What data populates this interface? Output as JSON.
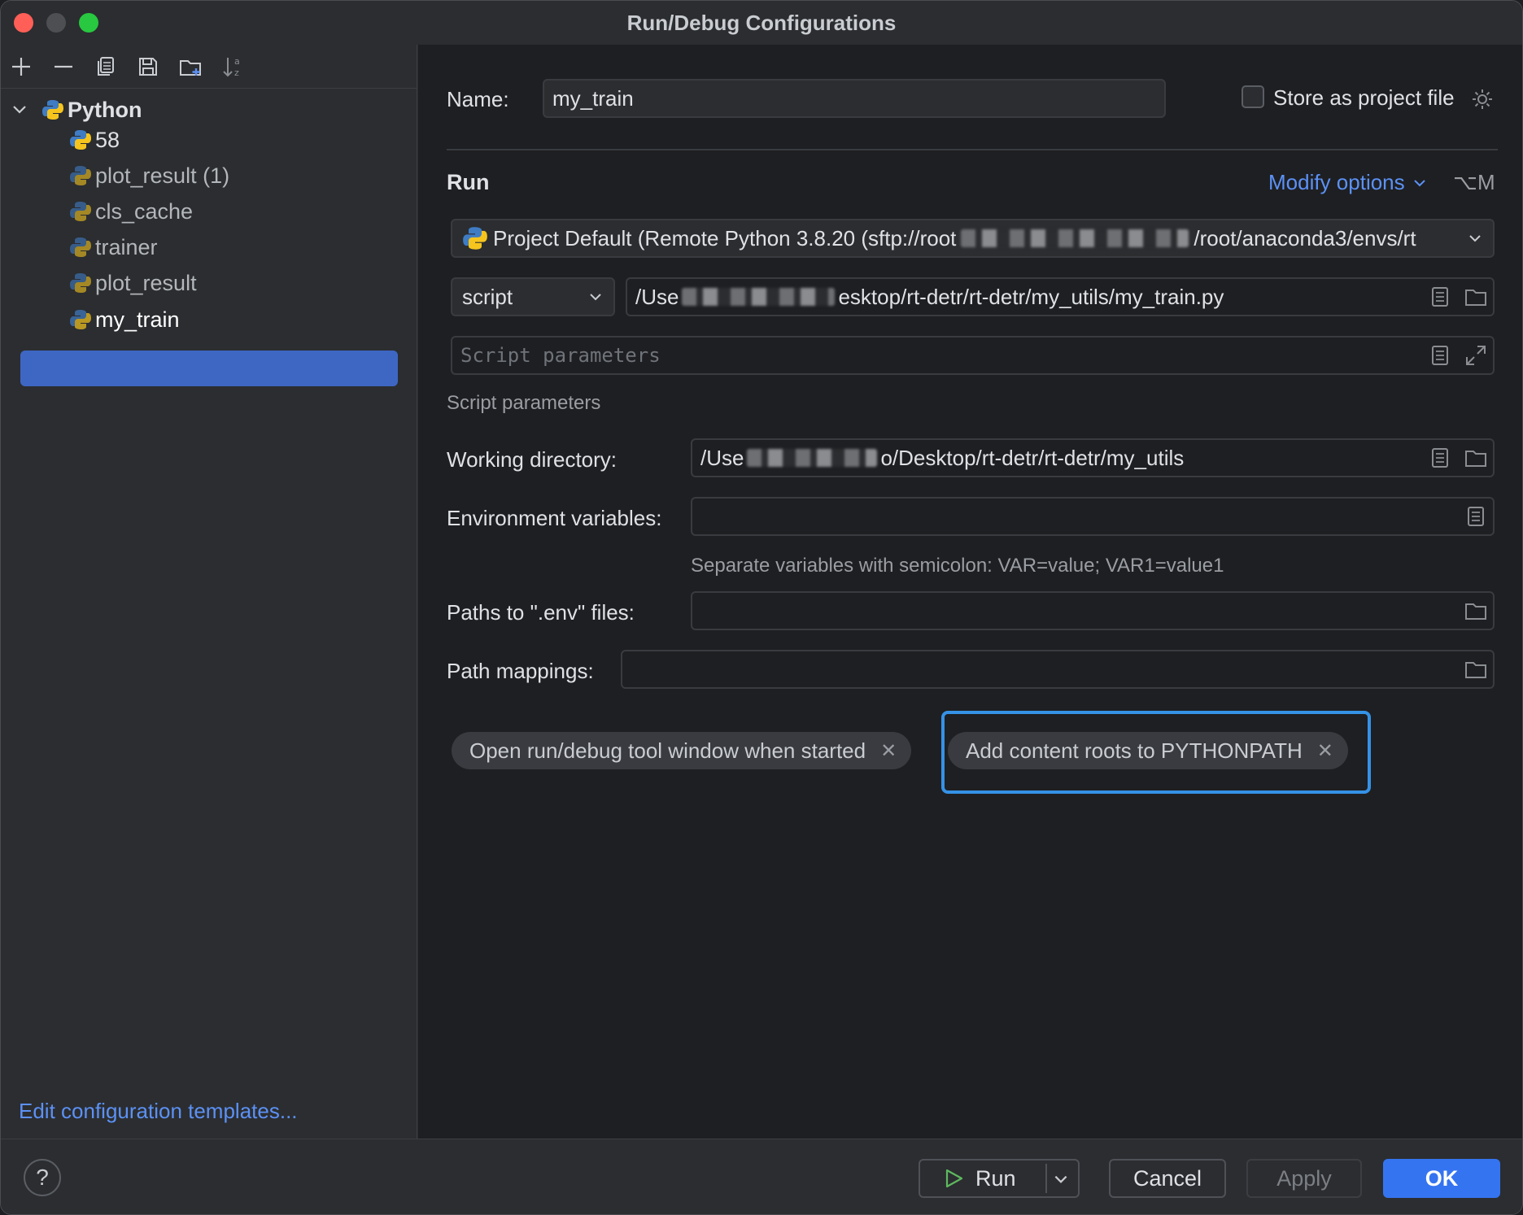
{
  "window": {
    "title": "Run/Debug Configurations"
  },
  "toolbar": {
    "icons": [
      "add-icon",
      "remove-icon",
      "copy-icon",
      "save-icon",
      "new-folder-icon",
      "sort-alphabetically-icon"
    ]
  },
  "tree": {
    "root": {
      "label": "Python",
      "expanded": true
    },
    "items": [
      {
        "label": "58",
        "selected": false
      },
      {
        "label": "plot_result (1)",
        "selected": false
      },
      {
        "label": "cls_cache",
        "selected": false
      },
      {
        "label": "trainer",
        "selected": false
      },
      {
        "label": "plot_result",
        "selected": false
      },
      {
        "label": "my_train",
        "selected": true
      }
    ],
    "edit_templates": "Edit configuration templates..."
  },
  "form": {
    "name_label": "Name:",
    "name_value": "my_train",
    "store_as_project_file": "Store as project file",
    "store_checked": false,
    "section_run": "Run",
    "modify_options": "Modify options",
    "modify_shortcut": "⌥M",
    "interpreter_prefix": "Project Default (Remote Python 3.8.20 (sftp://root",
    "interpreter_suffix": "/root/anaconda3/envs/rt",
    "run_type": "script",
    "script_path_prefix": "/Use",
    "script_path_suffix": "esktop/rt-detr/rt-detr/my_utils/my_train.py",
    "script_params_placeholder": "Script parameters",
    "script_params_hint": "Script parameters",
    "working_dir_label": "Working directory:",
    "working_dir_prefix": "/Use",
    "working_dir_suffix": "o/Desktop/rt-detr/rt-detr/my_utils",
    "env_vars_label": "Environment variables:",
    "env_vars_value": "",
    "env_vars_hint": "Separate variables with semicolon: VAR=value; VAR1=value1",
    "env_files_label": "Paths to \".env\" files:",
    "env_files_value": "",
    "path_mappings_label": "Path mappings:",
    "path_mappings_value": ""
  },
  "chips": [
    {
      "label": "Open run/debug tool window when started"
    },
    {
      "label": "Add content roots to PYTHONPATH",
      "focused": true
    }
  ],
  "buttons": {
    "help": "?",
    "run": "Run",
    "cancel": "Cancel",
    "apply": "Apply",
    "ok": "OK"
  },
  "colors": {
    "accent": "#3574f0",
    "selection": "#3e67c4",
    "link": "#5c91f5",
    "focus_ring": "#3592e6",
    "run_icon": "#5fb85f"
  }
}
